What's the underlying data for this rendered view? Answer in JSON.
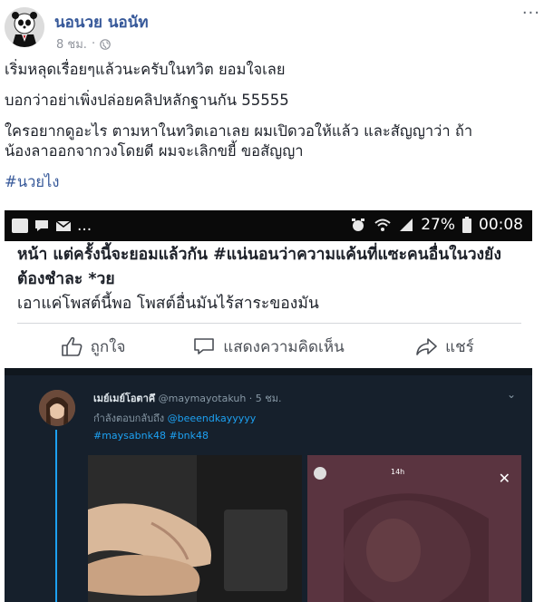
{
  "post": {
    "author": "นอนวย นอนัท",
    "time": "8 ชม.",
    "more_icon": "more-dots-icon",
    "paragraphs": [
      "เริ่มหลุดเรื่อยๆแล้วนะครับในทวิต ยอมใจเลย",
      "บอกว่าอย่าเพิ่งปล่อยคลิปหลักฐานกัน 55555",
      "ใครอยากดูอะไร ตามหาในทวิตเอาเลย ผมเปิดวอให้แล้ว และสัญญาว่า ถ้า",
      "น้องลาออกจากวงโดยดี ผมจะเลิกขยี้ ขอสัญญา"
    ],
    "hashtag": "#นวยไง"
  },
  "screenshot": {
    "status_bar": {
      "left_ellipsis": "...",
      "battery": "27%",
      "clock": "00:08"
    },
    "fb_card": {
      "line1": "หน้า แต่ครั้งนี้จะยอมแล้วกัน #แน่นอนว่าความแค้นที่แซะคนอื่นในวงยัง",
      "line2": "ต้องชำละ *วย",
      "line3": "เอาแค่โพสต์นี้พอ โพสต์อื่นมันไร้สาระของมัน",
      "actions": [
        {
          "label": "ถูกใจ",
          "icon": "like-thumb-icon"
        },
        {
          "label": "แสดงความคิดเห็น",
          "icon": "comment-bubble-icon"
        },
        {
          "label": "แชร์",
          "icon": "share-arrow-icon"
        }
      ]
    },
    "tweet": {
      "name": "เมย์เมย์โอตาคึ",
      "handle": "@maymayotakuh · 5 ชม.",
      "reply_prefix": "กำลังตอบกลับถึง",
      "reply_to": "@beeendkayyyyy",
      "tags": "#maysabnk48 #bnk48",
      "story_time": "14h"
    }
  },
  "colors": {
    "link": "#365899",
    "meta": "#90949c",
    "twitter_blue": "#1da1f2",
    "tweet_bg": "#16202c"
  }
}
